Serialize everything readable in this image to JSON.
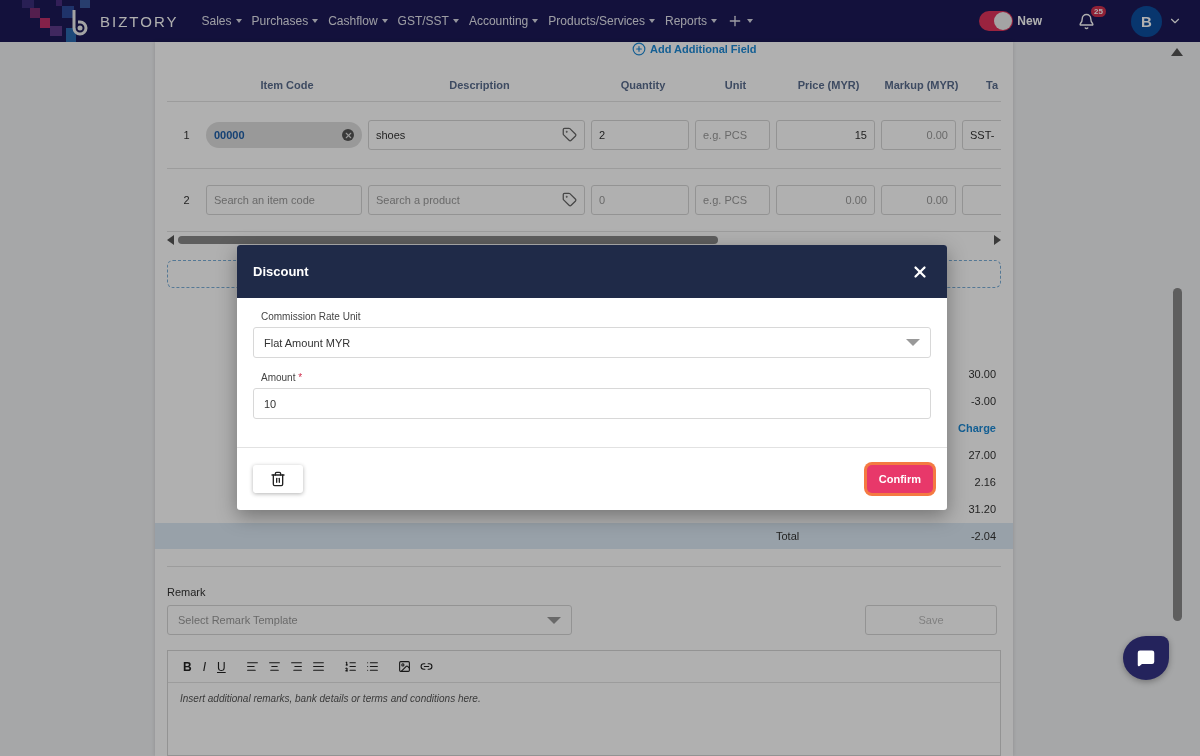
{
  "nav": {
    "brand": "BIZTORY",
    "menu": [
      {
        "label": "Sales"
      },
      {
        "label": "Purchases"
      },
      {
        "label": "Cashflow"
      },
      {
        "label": "GST/SST"
      },
      {
        "label": "Accounting"
      },
      {
        "label": "Products/Services"
      },
      {
        "label": "Reports"
      }
    ],
    "toggle": {
      "label": "New",
      "on": true
    },
    "notifications": "25",
    "avatar": "B"
  },
  "add_field": "Add Additional Field",
  "table": {
    "columns": [
      "Item Code",
      "Description",
      "Quantity",
      "Unit",
      "Price (MYR)",
      "Markup (MYR)",
      "Ta"
    ],
    "rows": [
      {
        "number": "1",
        "item_code": {
          "value": "00000"
        },
        "description": {
          "value": "shoes"
        },
        "quantity": {
          "value": "2"
        },
        "unit": {
          "placeholder": "e.g. PCS"
        },
        "price": {
          "value": "15"
        },
        "markup": {
          "placeholder": "0.00"
        },
        "tax": {
          "value": "SST-"
        }
      },
      {
        "number": "2",
        "item_code": {
          "placeholder": "Search an item code"
        },
        "description": {
          "placeholder": "Search a product"
        },
        "quantity": {
          "placeholder": "0"
        },
        "unit": {
          "placeholder": "e.g. PCS"
        },
        "price": {
          "placeholder": "0.00"
        },
        "markup": {
          "placeholder": "0.00"
        },
        "tax": {}
      }
    ]
  },
  "totals": [
    {
      "kind": "amount",
      "value": "30.00"
    },
    {
      "kind": "amount",
      "value": "-3.00"
    },
    {
      "kind": "link",
      "value": "Charge"
    },
    {
      "kind": "amount",
      "value": "27.00"
    },
    {
      "kind": "amount",
      "value": "2.16"
    },
    {
      "kind": "amount",
      "value": "31.20"
    },
    {
      "kind": "total",
      "label": "Total",
      "value": "-2.04"
    }
  ],
  "remark": {
    "label": "Remark",
    "template_placeholder": "Select Remark Template",
    "save": "Save",
    "format_buttons": [
      "B",
      "I",
      "U"
    ],
    "editor_placeholder": "Insert additional remarks, bank details or terms and conditions here."
  },
  "dialog": {
    "title": "Discount",
    "unit_label": "Commission Rate Unit",
    "unit_value": "Flat Amount MYR",
    "amount_label": "Amount",
    "amount_required": "*",
    "amount_value": "10",
    "confirm": "Confirm"
  }
}
